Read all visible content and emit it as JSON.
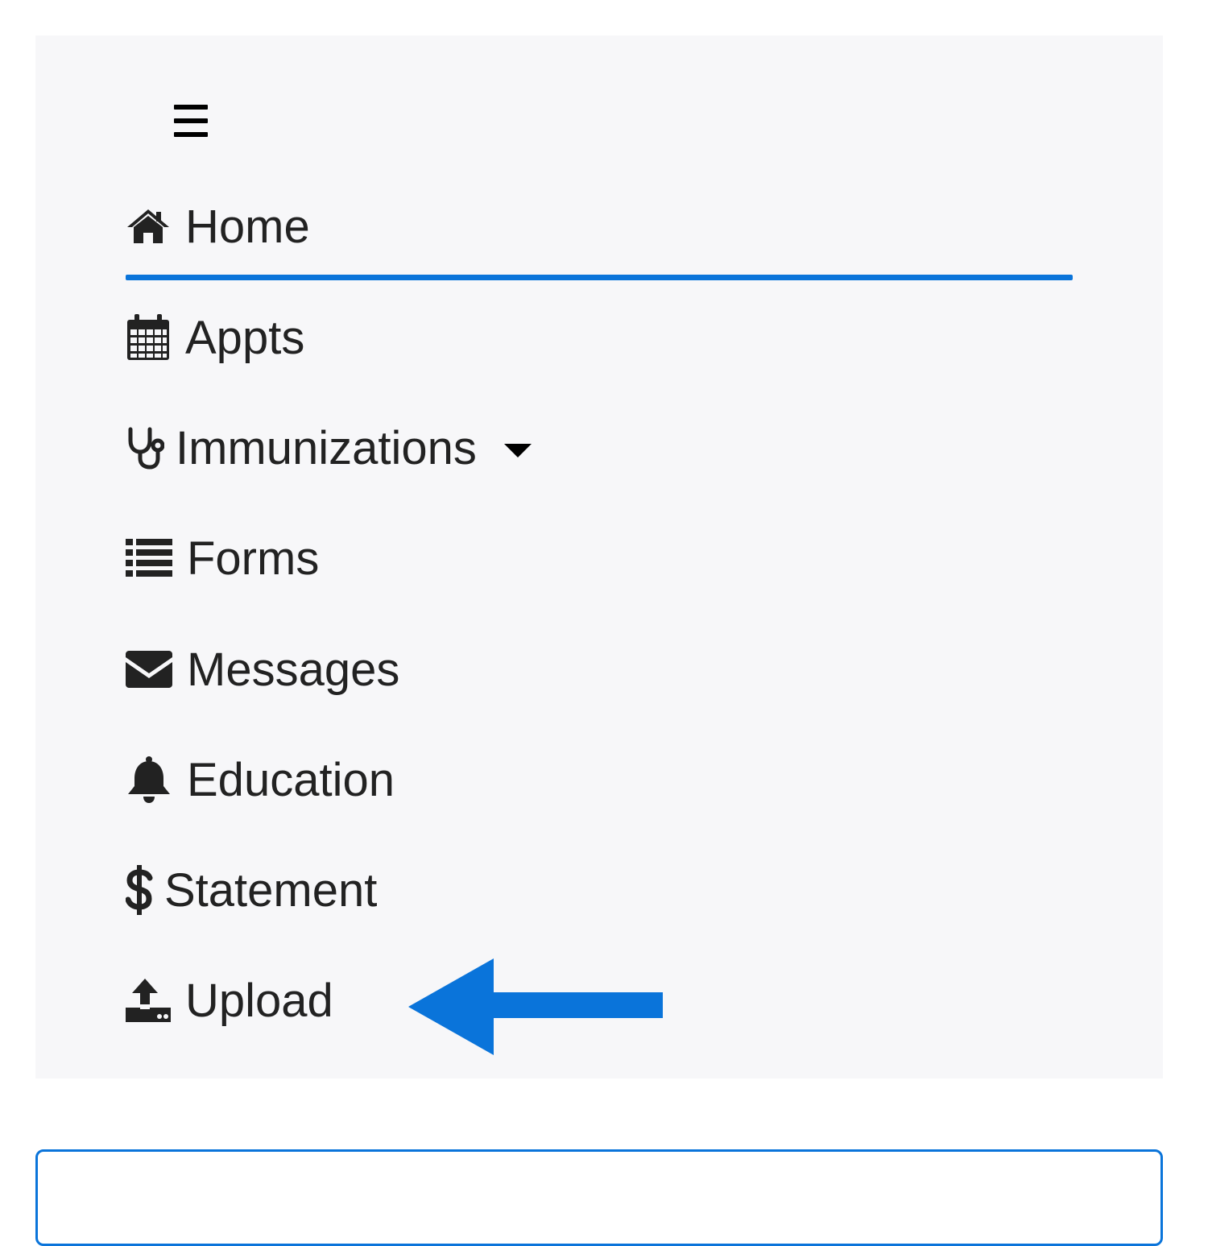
{
  "colors": {
    "accent": "#0a74da",
    "panel_background": "#f7f7f9",
    "text": "#222222"
  },
  "menu": {
    "toggle_icon": "hamburger-icon",
    "items": [
      {
        "label": "Home",
        "icon": "home-icon",
        "active": true
      },
      {
        "label": "Appts",
        "icon": "calendar-icon"
      },
      {
        "label": "Immunizations",
        "icon": "stethoscope-icon",
        "has_dropdown": true
      },
      {
        "label": "Forms",
        "icon": "list-icon"
      },
      {
        "label": "Messages",
        "icon": "envelope-icon"
      },
      {
        "label": "Education",
        "icon": "bell-icon"
      },
      {
        "label": "Statement",
        "icon": "dollar-icon"
      },
      {
        "label": "Upload",
        "icon": "upload-icon"
      }
    ]
  },
  "annotation": {
    "icon": "arrow-left-icon",
    "target": "Upload"
  }
}
